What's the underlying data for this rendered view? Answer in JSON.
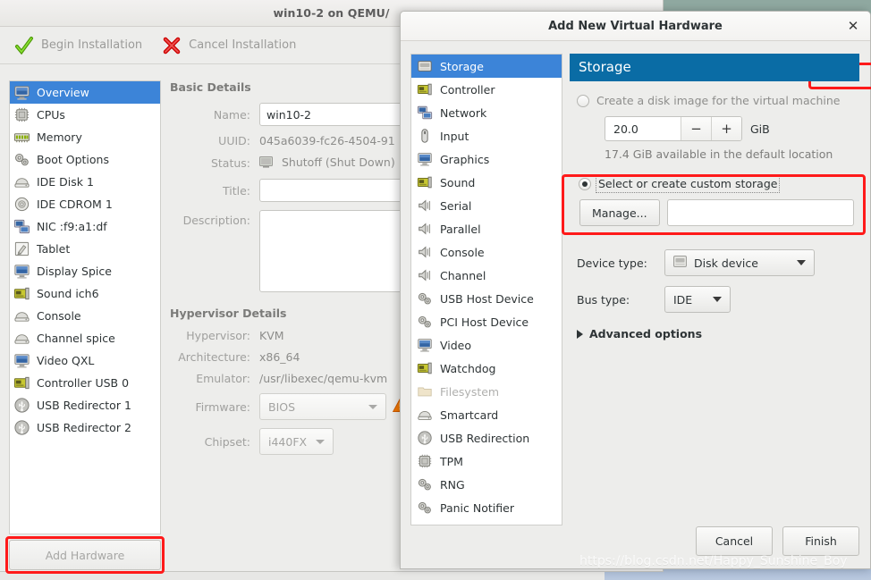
{
  "main_window": {
    "title": "win10-2 on QEMU/",
    "toolbar": [
      {
        "label": "Begin Installation",
        "icon": "check-icon"
      },
      {
        "label": "Cancel Installation",
        "icon": "cross-icon"
      }
    ],
    "hardware_list": [
      {
        "label": "Overview",
        "icon": "computer-icon",
        "selected": true
      },
      {
        "label": "CPUs",
        "icon": "cpu-icon",
        "selected": false
      },
      {
        "label": "Memory",
        "icon": "memory-icon",
        "selected": false
      },
      {
        "label": "Boot Options",
        "icon": "gears-icon",
        "selected": false
      },
      {
        "label": "IDE Disk 1",
        "icon": "harddisk-icon",
        "selected": false
      },
      {
        "label": "IDE CDROM 1",
        "icon": "cdrom-icon",
        "selected": false
      },
      {
        "label": "NIC :f9:a1:df",
        "icon": "network-icon",
        "selected": false
      },
      {
        "label": "Tablet",
        "icon": "tablet-icon",
        "selected": false
      },
      {
        "label": "Display Spice",
        "icon": "display-icon",
        "selected": false
      },
      {
        "label": "Sound ich6",
        "icon": "sound-icon",
        "selected": false
      },
      {
        "label": "Console",
        "icon": "console-icon",
        "selected": false
      },
      {
        "label": "Channel spice",
        "icon": "console-icon",
        "selected": false
      },
      {
        "label": "Video QXL",
        "icon": "video-icon",
        "selected": false
      },
      {
        "label": "Controller USB 0",
        "icon": "controller-icon",
        "selected": false
      },
      {
        "label": "USB Redirector 1",
        "icon": "usb-icon",
        "selected": false
      },
      {
        "label": "USB Redirector 2",
        "icon": "usb-icon",
        "selected": false
      }
    ],
    "add_hardware_label": "Add Hardware",
    "basic_details": {
      "heading": "Basic Details",
      "name_label": "Name:",
      "name_value": "win10-2",
      "uuid_label": "UUID:",
      "uuid_value": "045a6039-fc26-4504-91",
      "status_label": "Status:",
      "status_value": "Shutoff (Shut Down)",
      "title_label": "Title:",
      "title_value": "",
      "description_label": "Description:",
      "description_value": ""
    },
    "hypervisor_details": {
      "heading": "Hypervisor Details",
      "hypervisor_label": "Hypervisor:",
      "hypervisor_value": "KVM",
      "architecture_label": "Architecture:",
      "architecture_value": "x86_64",
      "emulator_label": "Emulator:",
      "emulator_value": "/usr/libexec/qemu-kvm",
      "firmware_label": "Firmware:",
      "firmware_value": "BIOS",
      "chipset_label": "Chipset:",
      "chipset_value": "i440FX"
    }
  },
  "dialog": {
    "title": "Add New Virtual Hardware",
    "close_label": "✕",
    "device_list": [
      {
        "label": "Storage",
        "icon": "storage-icon",
        "selected": true,
        "disabled": false
      },
      {
        "label": "Controller",
        "icon": "controller-icon",
        "selected": false,
        "disabled": false
      },
      {
        "label": "Network",
        "icon": "network-icon",
        "selected": false,
        "disabled": false
      },
      {
        "label": "Input",
        "icon": "mouse-icon",
        "selected": false,
        "disabled": false
      },
      {
        "label": "Graphics",
        "icon": "display-icon",
        "selected": false,
        "disabled": false
      },
      {
        "label": "Sound",
        "icon": "sound-card-icon",
        "selected": false,
        "disabled": false
      },
      {
        "label": "Serial",
        "icon": "serial-icon",
        "selected": false,
        "disabled": false
      },
      {
        "label": "Parallel",
        "icon": "serial-icon",
        "selected": false,
        "disabled": false
      },
      {
        "label": "Console",
        "icon": "serial-icon",
        "selected": false,
        "disabled": false
      },
      {
        "label": "Channel",
        "icon": "serial-icon",
        "selected": false,
        "disabled": false
      },
      {
        "label": "USB Host Device",
        "icon": "gears-icon",
        "selected": false,
        "disabled": false
      },
      {
        "label": "PCI Host Device",
        "icon": "gears-icon",
        "selected": false,
        "disabled": false
      },
      {
        "label": "Video",
        "icon": "video-icon",
        "selected": false,
        "disabled": false
      },
      {
        "label": "Watchdog",
        "icon": "controller-icon",
        "selected": false,
        "disabled": false
      },
      {
        "label": "Filesystem",
        "icon": "folder-icon",
        "selected": false,
        "disabled": true
      },
      {
        "label": "Smartcard",
        "icon": "smartcard-icon",
        "selected": false,
        "disabled": false
      },
      {
        "label": "USB Redirection",
        "icon": "usb-icon",
        "selected": false,
        "disabled": false
      },
      {
        "label": "TPM",
        "icon": "tpm-icon",
        "selected": false,
        "disabled": false
      },
      {
        "label": "RNG",
        "icon": "gears-icon",
        "selected": false,
        "disabled": false
      },
      {
        "label": "Panic Notifier",
        "icon": "gears-icon",
        "selected": false,
        "disabled": false
      }
    ],
    "panel": {
      "header": "Storage",
      "create_disk_label": "Create a disk image for the virtual machine",
      "create_disk_selected": false,
      "size_value": "20.0",
      "minus_label": "−",
      "plus_label": "+",
      "size_unit": "GiB",
      "available_note": "17.4 GiB available in the default location",
      "custom_storage_label": "Select or create custom storage",
      "custom_storage_selected": true,
      "manage_label": "Manage...",
      "path_value": "",
      "device_type_label": "Device type:",
      "device_type_value": "Disk device",
      "bus_type_label": "Bus type:",
      "bus_type_value": "IDE",
      "advanced_label": "Advanced options"
    },
    "footer": {
      "cancel_label": "Cancel",
      "finish_label": "Finish"
    }
  },
  "watermark": "https://blog.csdn.net/Happy_Sunshine_Boy",
  "colors": {
    "selection_blue": "#3c84d8",
    "panel_header_blue": "#0a6ca5",
    "annotation_red": "#ff1a1a",
    "desktop_green": "#8fa8a0"
  }
}
